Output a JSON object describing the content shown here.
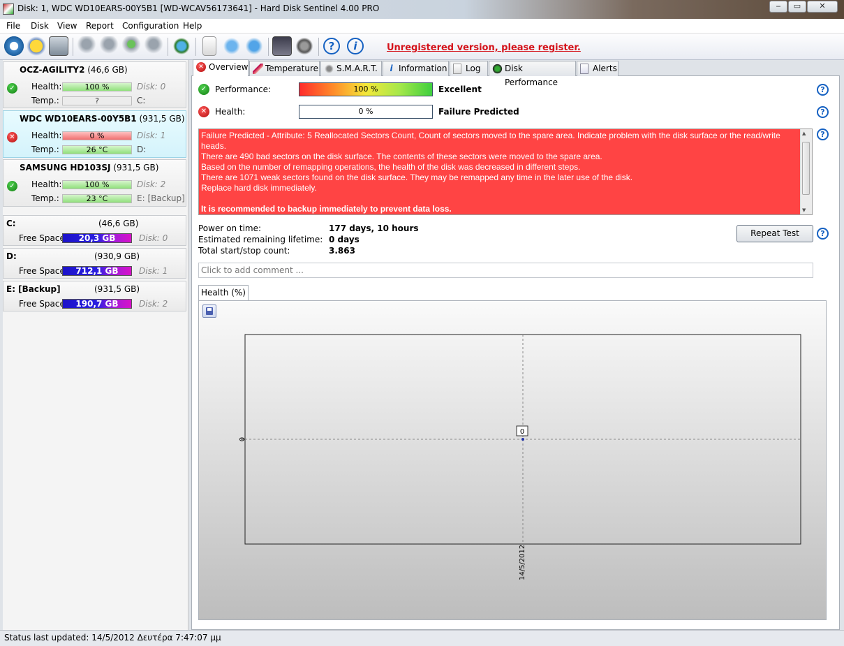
{
  "window": {
    "title": "Disk: 1, WDC WD10EARS-00Y5B1 [WD-WCAV56173641]  -  Hard Disk Sentinel 4.00 PRO"
  },
  "menu": [
    "File",
    "Disk",
    "View",
    "Report",
    "Configuration",
    "Help"
  ],
  "toolbar": {
    "register_text": "Unregistered version, please register."
  },
  "disks": [
    {
      "name": "OCZ-AGILITY2",
      "size": "(46,6 GB)",
      "health": "100 %",
      "temp": "?",
      "disk": "Disk: 0",
      "drive": "C:",
      "status": "ok"
    },
    {
      "name": "WDC WD10EARS-00Y5B1",
      "size": "(931,5 GB)",
      "health": "0 %",
      "temp": "26 °C",
      "disk": "Disk: 1",
      "drive": "D:",
      "status": "bad"
    },
    {
      "name": "SAMSUNG HD103SJ",
      "size": "(931,5 GB)",
      "health": "100 %",
      "temp": "23 °C",
      "disk": "Disk: 2",
      "drive": "E: [Backup]",
      "status": "ok"
    }
  ],
  "labels": {
    "health": "Health:",
    "temp": "Temp.:",
    "free_space": "Free Space"
  },
  "volumes": [
    {
      "name": "C:",
      "size": "(46,6 GB)",
      "free": "20,3 GB",
      "disk": "Disk: 0"
    },
    {
      "name": "D:",
      "size": "(930,9 GB)",
      "free": "712,1 GB",
      "disk": "Disk: 1"
    },
    {
      "name": "E: [Backup]",
      "size": "(931,5 GB)",
      "free": "190,7 GB",
      "disk": "Disk: 2"
    }
  ],
  "tabs": [
    "Overview",
    "Temperature",
    "S.M.A.R.T.",
    "Information",
    "Log",
    "Disk Performance",
    "Alerts"
  ],
  "overview": {
    "performance_label": "Performance:",
    "performance_value": "100 %",
    "performance_text": "Excellent",
    "health_label": "Health:",
    "health_value": "0 %",
    "health_text": "Failure Predicted",
    "alert_lines": [
      "Failure Predicted - Attribute: 5 Reallocated Sectors Count, Count of sectors moved to the spare area. Indicate problem with the disk surface or the read/write heads.",
      "There are 490 bad sectors on the disk surface. The contents of these sectors were moved to the spare area.",
      "Based on the number of remapping operations, the health of the disk was decreased in different steps.",
      "There are 1071 weak sectors found on the disk surface. They may be remapped any time in the later use of the disk.",
      "Replace hard disk immediately.",
      "",
      "It is recommended to backup immediately to prevent data loss."
    ],
    "power_on_label": "Power on time:",
    "power_on_value": "177 days, 10 hours",
    "lifetime_label": "Estimated remaining lifetime:",
    "lifetime_value": "0 days",
    "startstop_label": "Total start/stop count:",
    "startstop_value": "3.863",
    "repeat_test": "Repeat Test",
    "comment_placeholder": "Click to add comment ...",
    "chart_tab": "Health (%)"
  },
  "chart_data": {
    "type": "line",
    "x": [
      "14/5/2012"
    ],
    "series": [
      {
        "values": [
          0
        ]
      }
    ],
    "ytick": "0",
    "point_label": "0",
    "grid": true
  },
  "statusbar": {
    "text": "Status last updated: 14/5/2012 Δευτέρα 7:47:07 μμ"
  }
}
